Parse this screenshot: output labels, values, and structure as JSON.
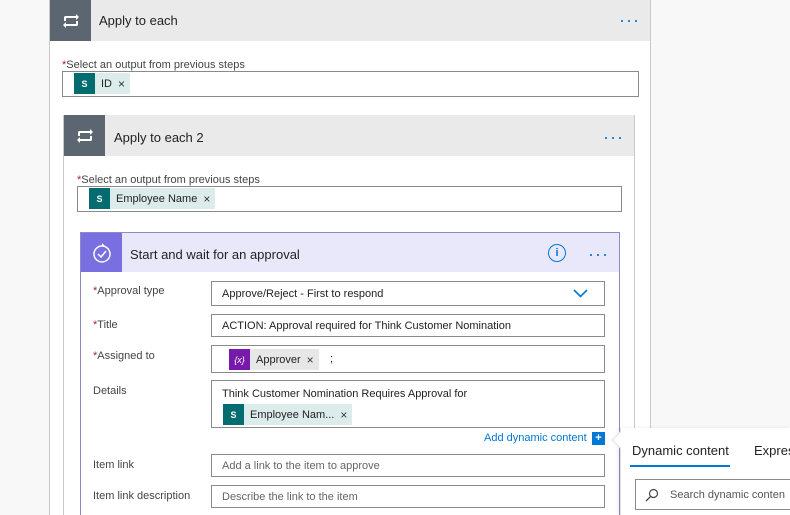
{
  "outer_loop": {
    "title": "Apply to each",
    "select_label": "Select an output from previous steps",
    "token": {
      "icon_text": "S",
      "label": "ID"
    }
  },
  "inner_loop": {
    "title": "Apply to each 2",
    "select_label": "Select an output from previous steps",
    "token": {
      "icon_text": "S",
      "label": "Employee Name"
    }
  },
  "approval": {
    "title": "Start and wait for an approval",
    "approval_type": {
      "label": "Approval type",
      "value": "Approve/Reject - First to respond"
    },
    "title_field": {
      "label": "Title",
      "value": "ACTION: Approval required for Think Customer Nomination"
    },
    "assigned_to": {
      "label": "Assigned to",
      "token_label": "Approver",
      "token_icon": "{x}",
      "suffix": ";"
    },
    "details": {
      "label": "Details",
      "text": "Think Customer Nomination Requires Approval for",
      "token_label": "Employee Nam...",
      "token_icon": "S"
    },
    "add_dynamic": "Add dynamic content",
    "item_link": {
      "label": "Item link",
      "placeholder": "Add a link to the item to approve"
    },
    "item_link_description": {
      "label": "Item link description",
      "placeholder": "Describe the link to the item"
    }
  },
  "dynamic_panel": {
    "tabs": [
      "Dynamic content",
      "Expres"
    ],
    "search_placeholder": "Search dynamic conten"
  },
  "colors": {
    "accent": "#0078d4",
    "sharepoint": "#036c70",
    "approval": "#7a6fe0",
    "variable": "#7719aa",
    "required": "#a4262c"
  }
}
